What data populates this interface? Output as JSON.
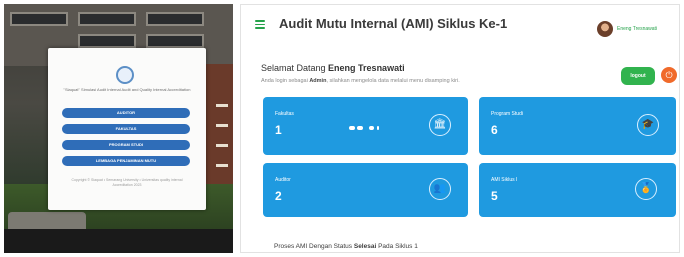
{
  "login": {
    "welcome_text": "\"Siaquat\" Simulasi Audit Internal Audit and Quality Internal Accreditation",
    "buttons": [
      "AUDITOR",
      "FAKULTAS",
      "PROGRAM STUDI",
      "LEMBAGA PENJAMINAN MUTU"
    ],
    "copyright": "Copyright © Siaquat • Semarang University • Universitas quality internal Accreditation 2023"
  },
  "app": {
    "title": "Audit Mutu Internal (AMI) Siklus Ke-1",
    "user_name": "Eneng Tresnawati",
    "welcome_prefix": "Selamat Datang ",
    "welcome_name": "Eneng Tresnawati",
    "subtext_prefix": "Anda login sebagai ",
    "subtext_role": "Admin",
    "subtext_suffix": ", silahkan mengelola data melalui menu disamping kiri.",
    "logout_label": "logout",
    "power_icon": "⏻",
    "cards": [
      {
        "label": "Fakultas",
        "value": "1",
        "icon": "building-icon",
        "glyph": "🏛"
      },
      {
        "label": "Program Studi",
        "value": "6",
        "icon": "graduation-cap-icon",
        "glyph": "🎓"
      },
      {
        "label": "Auditor",
        "value": "2",
        "icon": "users-icon",
        "glyph": "👥"
      },
      {
        "label": "AMI Siklus I",
        "value": "5",
        "icon": "award-icon",
        "glyph": "🏅"
      }
    ],
    "footer_prefix": "Proses AMI Dengan Status ",
    "footer_status": "Selesai",
    "footer_suffix": " Pada Siklus 1"
  },
  "colors": {
    "accent_green": "#27a34c",
    "card_blue": "#1f9ae0",
    "login_button_blue": "#2f6db8",
    "power_orange": "#f06a2a"
  }
}
